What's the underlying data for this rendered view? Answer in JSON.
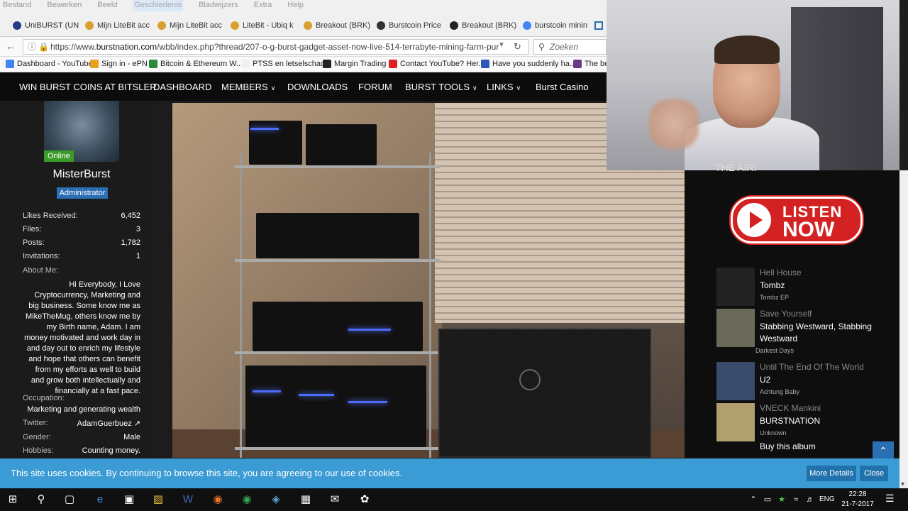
{
  "menubar": [
    "Bestand",
    "Bewerken",
    "Beeld",
    "Geschiedenis",
    "Bladwijzers",
    "Extra",
    "Help"
  ],
  "tabs": [
    {
      "label": "UniBURST (UN",
      "color": "#2a3a8a"
    },
    {
      "label": "Mijn LiteBit acc",
      "color": "#d8a030"
    },
    {
      "label": "Mijn LiteBit acc",
      "color": "#d8a030"
    },
    {
      "label": "LiteBit - Ubiq k",
      "color": "#d8a030"
    },
    {
      "label": "Breakout (BRK)",
      "color": "#d8a030"
    },
    {
      "label": "Burstcoin Price",
      "color": "#333333"
    },
    {
      "label": "Breakout (BRK)",
      "color": "#222222"
    },
    {
      "label": "burstcoin minin",
      "color": "#4285f4"
    }
  ],
  "address": {
    "prefix": "https://www.",
    "domain": "burstnation.com",
    "path": "/wbb/index.php?thread/207-o-g-burst-gadget-asset-now-live-514-terrabyte-mining-farm-pur",
    "search_placeholder": "Zoeken"
  },
  "bookmarks": [
    {
      "label": "Dashboard - YouTube",
      "color": "#4285f4"
    },
    {
      "label": "Sign in - ePN",
      "color": "#e8a020"
    },
    {
      "label": "Bitcoin & Ethereum W...",
      "color": "#2a8a3a"
    },
    {
      "label": "PTSS en letselschade",
      "color": "#f0f0f0"
    },
    {
      "label": "Margin Trading",
      "color": "#222222"
    },
    {
      "label": "Contact YouTube? Her...",
      "color": "#e02020"
    },
    {
      "label": "Have you suddenly ha...",
      "color": "#2a5ab5"
    },
    {
      "label": "The be",
      "color": "#6a3a8a"
    }
  ],
  "sitenav": [
    {
      "label": "WIN BURST COINS AT BITSLER",
      "dropdown": false
    },
    {
      "label": "DASHBOARD",
      "dropdown": false
    },
    {
      "label": "MEMBERS",
      "dropdown": true
    },
    {
      "label": "DOWNLOADS",
      "dropdown": false
    },
    {
      "label": "FORUM",
      "dropdown": false
    },
    {
      "label": "BURST TOOLS",
      "dropdown": true
    },
    {
      "label": "LINKS",
      "dropdown": true
    },
    {
      "label": "Burst Casino",
      "dropdown": false
    }
  ],
  "profile": {
    "online": "Online",
    "username": "MisterBurst",
    "role": "Administrator",
    "stats": [
      {
        "label": "Likes Received:",
        "value": "6,452"
      },
      {
        "label": "Files:",
        "value": "3"
      },
      {
        "label": "Posts:",
        "value": "1,782"
      },
      {
        "label": "Invitations:",
        "value": "1"
      }
    ],
    "about_label": "About Me:",
    "about": "Hi Everybody, I Love Cryptocurrency, Marketing and big business. Some know me as MikeTheMug, others know me by my Birth name, Adam. I am money motivated and work day in and day out to enrich my lifestyle and hope that others can benefit from my efforts as well to build and grow both intellectually and financially at a fast pace.",
    "occupation_label": "Occupation:",
    "occupation": "Marketing and generating wealth",
    "twitter_label": "Twitter:",
    "twitter": "AdamGuerbuez",
    "gender_label": "Gender:",
    "gender": "Male",
    "hobbies_label": "Hobbies:",
    "hobbies": "Counting money."
  },
  "radio": {
    "header_partial": "THE AIR!",
    "listen_line1": "LISTEN",
    "listen_line2": "NOW",
    "tracks": [
      {
        "title": "Hell House",
        "artist": "Tombz",
        "album": "Tombz EP"
      },
      {
        "title": "Save Yourself",
        "artist": "Stabbing Westward, Stabbing Westward",
        "album": "Darkest Days"
      },
      {
        "title": "Until The End Of The World",
        "artist": "U2",
        "album": "Achtung Baby"
      },
      {
        "title": "VNECK Mankini",
        "artist": "BURSTNATION",
        "album": "Unknown"
      }
    ],
    "buy": "Buy this album"
  },
  "cookie": {
    "message": "This site uses cookies. By continuing to browse this site, you are agreeing to our use of cookies.",
    "more": "More Details",
    "close": "Close"
  },
  "taskbar": {
    "lang": "ENG",
    "time": "22:28",
    "date": "21-7-2017"
  }
}
